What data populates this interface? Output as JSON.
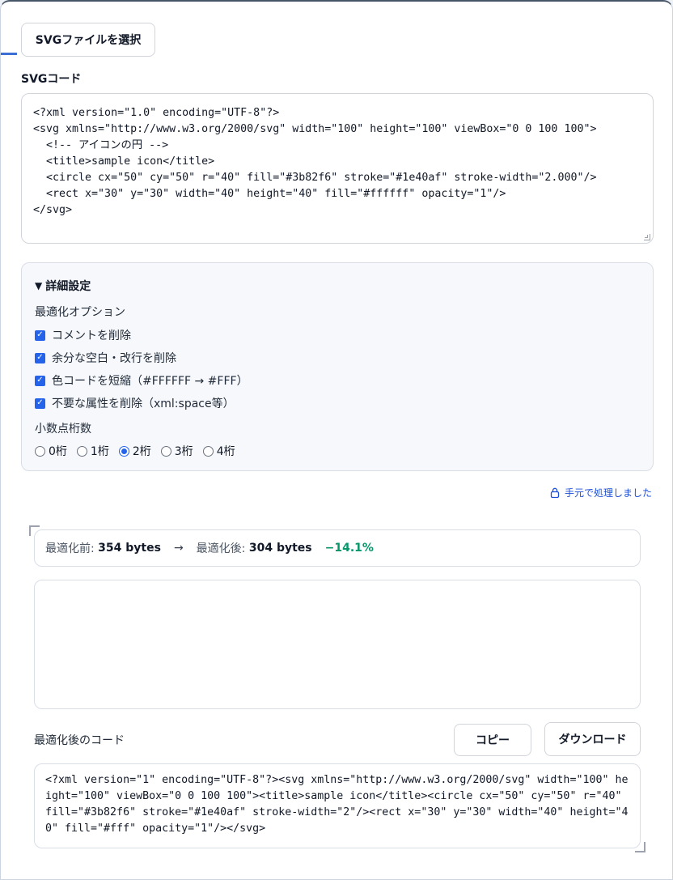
{
  "file_button_label": "SVGファイルを選択",
  "svg_code_label": "SVGコード",
  "input_code_lines": [
    "<?xml version=\"1.0\" encoding=\"UTF-8\"?>",
    "<svg xmlns=\"http://www.w3.org/2000/svg\" width=\"100\" height=\"100\" viewBox=\"0 0 100 100\">",
    "  <!-- アイコンの円 -->",
    "  <title>sample icon</title>",
    "  <circle cx=\"50\" cy=\"50\" r=\"40\" fill=\"#3b82f6\" stroke=\"#1e40af\" stroke-width=\"2.000\"/>",
    "  <rect x=\"30\" y=\"30\" width=\"40\" height=\"40\" fill=\"#ffffff\" opacity=\"1\"/>",
    "</svg>"
  ],
  "details": {
    "summary": "詳細設定",
    "optimize_label": "最適化オプション",
    "options": [
      {
        "label": "コメントを削除",
        "checked": true
      },
      {
        "label": "余分な空白・改行を削除",
        "checked": true
      },
      {
        "label": "色コードを短縮（#FFFFFF → #FFF）",
        "checked": true
      },
      {
        "label": "不要な属性を削除（xml:space等）",
        "checked": true
      }
    ],
    "decimal_label": "小数点桁数",
    "decimal_options": [
      "0桁",
      "1桁",
      "2桁",
      "3桁",
      "4桁"
    ],
    "decimal_selected": "2桁"
  },
  "local_note": "手元で処理しました",
  "stats": {
    "before_label": "最適化前:",
    "before_value": "354 bytes",
    "arrow": "→",
    "after_label": "最適化後:",
    "after_value": "304 bytes",
    "reduction": "−14.1%"
  },
  "output_label": "最適化後のコード",
  "copy_label": "コピー",
  "download_label": "ダウンロード",
  "output_code": "<?xml version=\"1\" encoding=\"UTF-8\"?><svg xmlns=\"http://www.w3.org/2000/svg\" width=\"100\" height=\"100\" viewBox=\"0 0 100 100\"><title>sample icon</title><circle cx=\"50\" cy=\"50\" r=\"40\" fill=\"#3b82f6\" stroke=\"#1e40af\" stroke-width=\"2\"/><rect x=\"30\" y=\"30\" width=\"40\" height=\"40\" fill=\"#fff\" opacity=\"1\"/></svg>",
  "colors": {
    "accent": "#2563eb",
    "reduction_green": "#059669"
  }
}
